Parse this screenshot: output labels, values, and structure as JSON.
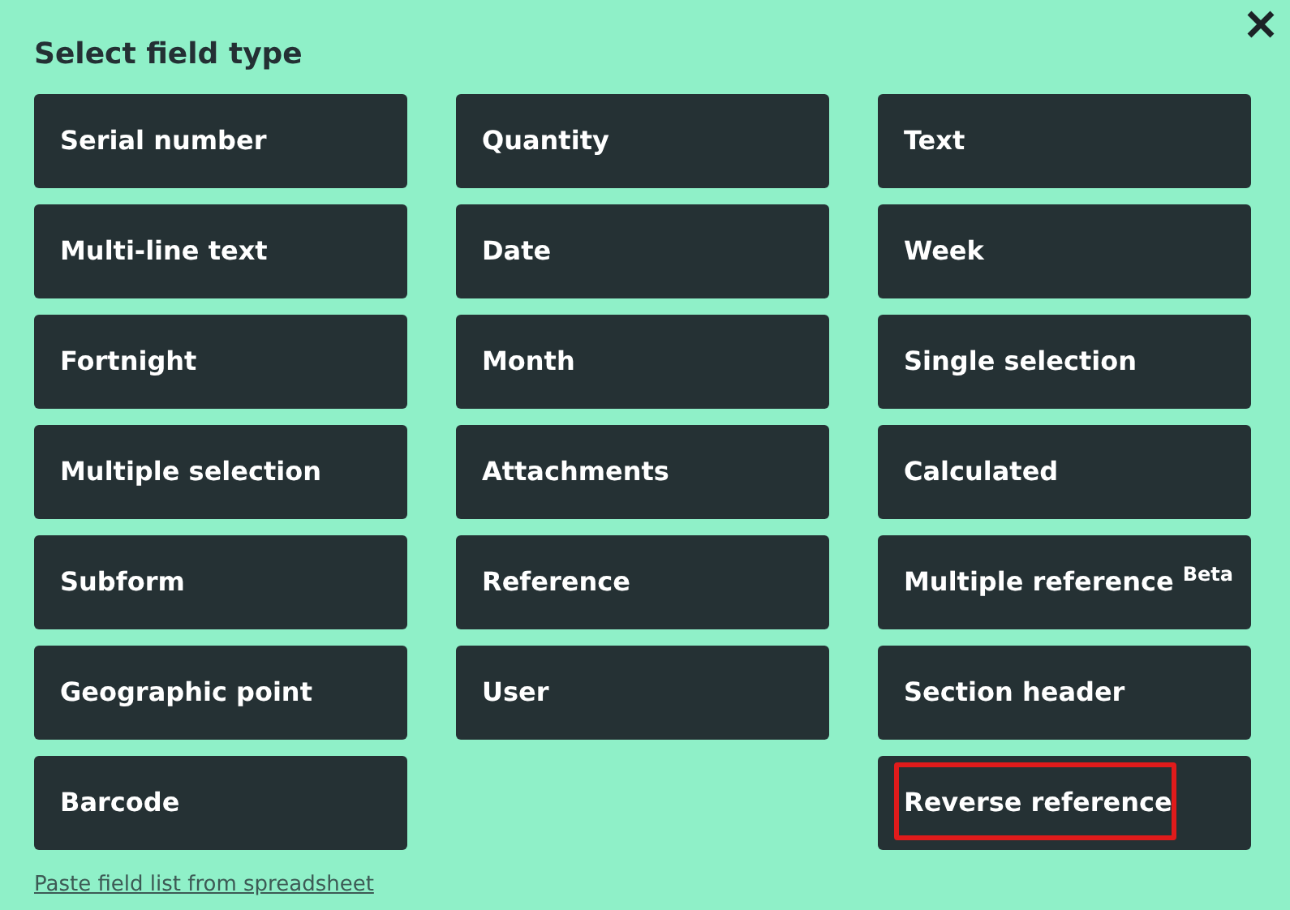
{
  "title": "Select field type",
  "columns": [
    [
      {
        "label": "Serial number",
        "highlighted": false
      },
      {
        "label": "Multi-line text",
        "highlighted": false
      },
      {
        "label": "Fortnight",
        "highlighted": false
      },
      {
        "label": "Multiple selection",
        "highlighted": false
      },
      {
        "label": "Subform",
        "highlighted": false
      },
      {
        "label": "Geographic point",
        "highlighted": false
      },
      {
        "label": "Barcode",
        "highlighted": false
      }
    ],
    [
      {
        "label": "Quantity",
        "highlighted": false
      },
      {
        "label": "Date",
        "highlighted": false
      },
      {
        "label": "Month",
        "highlighted": false
      },
      {
        "label": "Attachments",
        "highlighted": false
      },
      {
        "label": "Reference",
        "highlighted": false
      },
      {
        "label": "User",
        "highlighted": false
      }
    ],
    [
      {
        "label": "Text",
        "highlighted": false
      },
      {
        "label": "Week",
        "highlighted": false
      },
      {
        "label": "Single selection",
        "highlighted": false
      },
      {
        "label": "Calculated",
        "highlighted": false
      },
      {
        "label": "Multiple reference $^{Beta}$",
        "highlighted": false
      },
      {
        "label": "Section header",
        "highlighted": false
      },
      {
        "label": "Reverse reference",
        "highlighted": true
      }
    ]
  ],
  "link": "Paste field list from spreadsheet"
}
